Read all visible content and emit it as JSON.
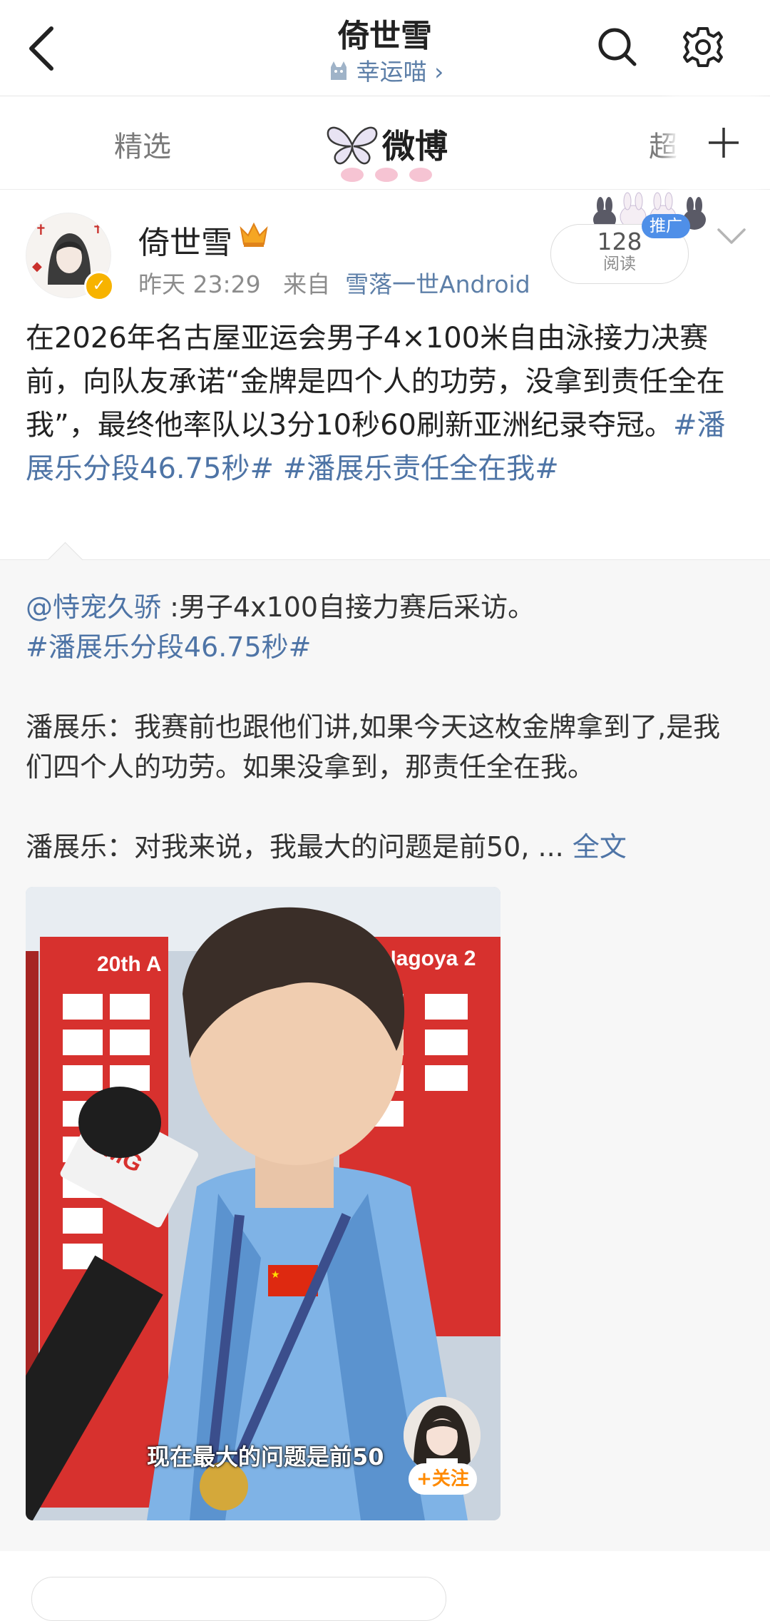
{
  "header": {
    "title": "倚世雪",
    "subtitle": "幸运喵 ›"
  },
  "tabs": {
    "items": [
      "精选",
      "微博",
      "超"
    ]
  },
  "post": {
    "username": "倚世雪",
    "time": "昨天 23:29",
    "from_label": "来自",
    "source": "雪落一世Android",
    "read_count": "128",
    "read_label": "阅读",
    "promo_label": "推广",
    "text_plain": "在2026年名古屋亚运会男子4×100米自由泳接力决赛前，向队友承诺“金牌是四个人的功劳，没拿到责任全在我”，最终他率队以3分10秒60刷新亚洲纪录夺冠。",
    "tag1": "#潘展乐分段46.75秒#",
    "tag2": "#潘展乐责任全在我#"
  },
  "repost": {
    "mention": "@恃宠久骄",
    "lead": ":男子4x100自接力赛后采访。",
    "tag": "#潘展乐分段46.75秒#",
    "para1": "潘展乐：我赛前也跟他们讲,如果今天这枚金牌拿到了,是我们四个人的功劳。如果没拿到，那责任全在我。",
    "para2": "潘展乐：对我来说，我最大的问题是前50, ... ",
    "full_text_link": "全文",
    "video": {
      "board_left": "20th A",
      "board_right": "-Nagoya 2",
      "mic_brand": "CMG",
      "caption": "现在最大的问题是前50",
      "follow_label": "+关注"
    }
  },
  "colors": {
    "link": "#4e74a6",
    "meta": "#8c8c8c",
    "promo": "#4f8fe8",
    "follow": "#ff8a00"
  }
}
